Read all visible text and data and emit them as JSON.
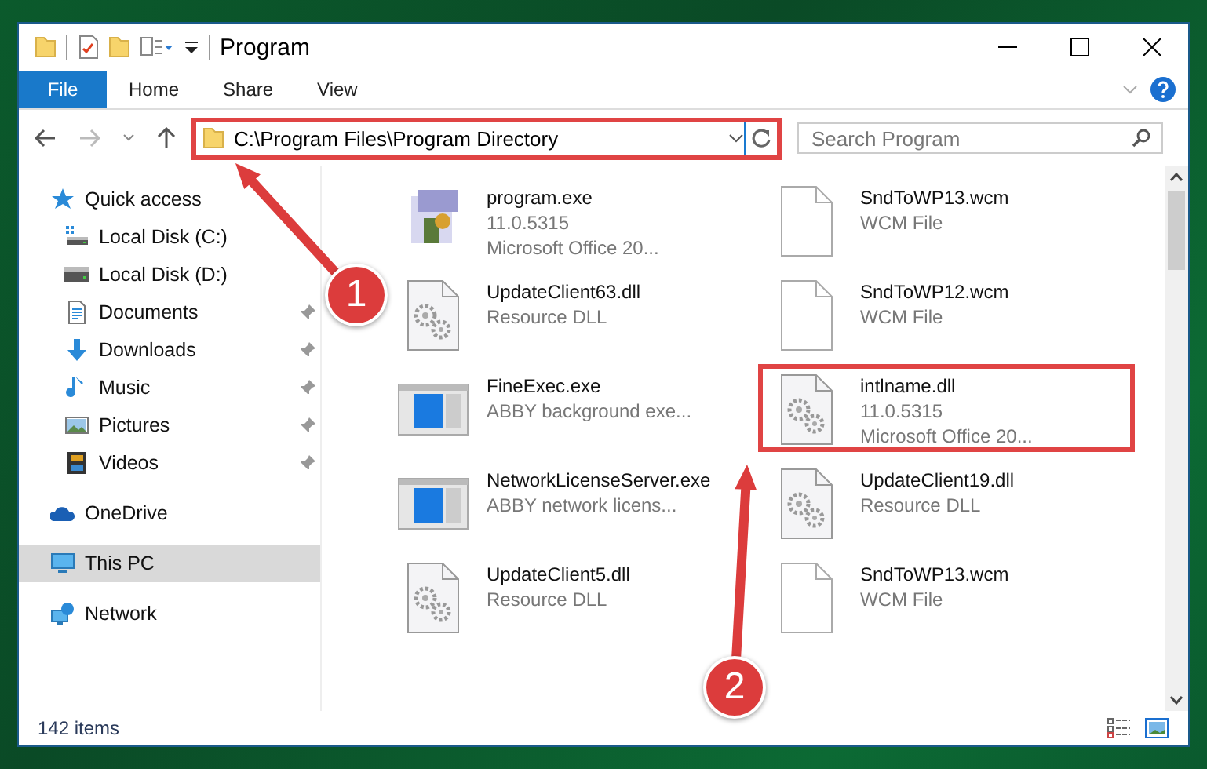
{
  "window": {
    "title": "Program"
  },
  "ribbon_tabs": [
    {
      "label": "File",
      "kind": "menu"
    },
    {
      "label": "Home",
      "kind": "tab"
    },
    {
      "label": "Share",
      "kind": "tab"
    },
    {
      "label": "View",
      "kind": "tab"
    }
  ],
  "address_bar": {
    "path": "C:\\Program Files\\Program Directory",
    "highlighted": true
  },
  "search": {
    "placeholder": "Search Program"
  },
  "sidebar": {
    "items": [
      {
        "label": "Quick access",
        "selected": false,
        "children": [
          {
            "label": "Local Disk (C:)"
          },
          {
            "label": "Local Disk (D:)"
          },
          {
            "label": "Documents",
            "pinned": true
          },
          {
            "label": "Downloads",
            "pinned": true
          },
          {
            "label": "Music",
            "pinned": true
          },
          {
            "label": "Pictures",
            "pinned": true
          },
          {
            "label": "Videos",
            "pinned": true
          }
        ]
      },
      {
        "label": "OneDrive",
        "selected": false
      },
      {
        "label": "This PC",
        "selected": true
      },
      {
        "label": "Network",
        "selected": false
      }
    ]
  },
  "files": [
    {
      "name": "program.exe",
      "details": [
        "11.0.5315",
        "Microsoft Office 20..."
      ],
      "kind": "application",
      "highlighted": false
    },
    {
      "name": "SndToWP13.wcm",
      "details": [
        "WCM File"
      ],
      "kind": "blank",
      "highlighted": false
    },
    {
      "name": "UpdateClient63.dll",
      "details": [
        "Resource DLL"
      ],
      "kind": "library",
      "highlighted": false
    },
    {
      "name": "SndToWP12.wcm",
      "details": [
        "WCM File"
      ],
      "kind": "blank",
      "highlighted": false
    },
    {
      "name": "FineExec.exe",
      "details": [
        "ABBY background exe..."
      ],
      "kind": "program",
      "highlighted": false
    },
    {
      "name": "intlname.dll",
      "details": [
        "11.0.5315",
        "Microsoft Office 20..."
      ],
      "kind": "library",
      "highlighted": true
    },
    {
      "name": "NetworkLicenseServer.exe",
      "details": [
        "ABBY network licens..."
      ],
      "kind": "program",
      "highlighted": false
    },
    {
      "name": "UpdateClient19.dll",
      "details": [
        "Resource DLL"
      ],
      "kind": "library",
      "highlighted": false
    },
    {
      "name": "UpdateClient5.dll",
      "details": [
        "Resource DLL"
      ],
      "kind": "library",
      "highlighted": false
    },
    {
      "name": "SndToWP13.wcm",
      "details": [
        "WCM File"
      ],
      "kind": "blank",
      "highlighted": false
    }
  ],
  "callouts": [
    {
      "number": "1"
    },
    {
      "number": "2"
    }
  ],
  "status_bar": {
    "item_count": "142 items"
  }
}
